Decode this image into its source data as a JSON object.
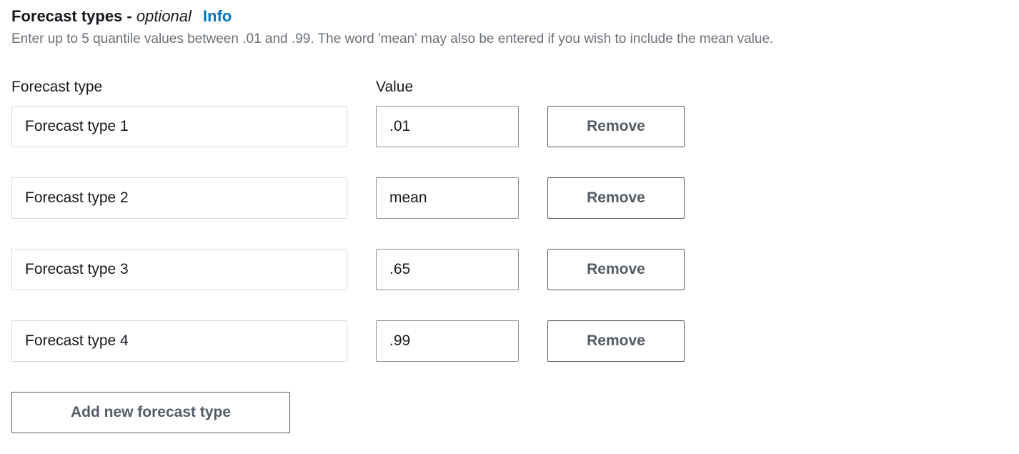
{
  "header": {
    "title_prefix": "Forecast types - ",
    "optional_text": "optional",
    "info_link": "Info"
  },
  "helper_text": "Enter up to 5 quantile values between .01 and .99. The word 'mean' may also be entered if you wish to include the mean value.",
  "columns": {
    "type_label": "Forecast type",
    "value_label": "Value"
  },
  "rows": [
    {
      "type_label": "Forecast type 1",
      "value": ".01",
      "remove_label": "Remove"
    },
    {
      "type_label": "Forecast type 2",
      "value": "mean",
      "remove_label": "Remove"
    },
    {
      "type_label": "Forecast type 3",
      "value": ".65",
      "remove_label": "Remove"
    },
    {
      "type_label": "Forecast type 4",
      "value": ".99",
      "remove_label": "Remove"
    }
  ],
  "add_button_label": "Add new forecast type"
}
